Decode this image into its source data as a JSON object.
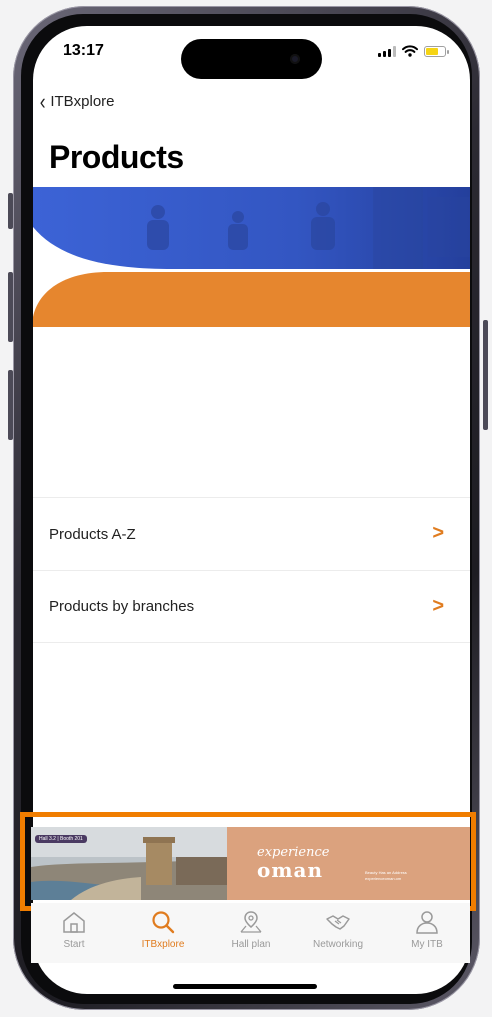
{
  "status_bar": {
    "time": "13:17"
  },
  "nav": {
    "back_label": "ITBxplore"
  },
  "page": {
    "title": "Products"
  },
  "list": {
    "items": [
      {
        "label": "Products A-Z",
        "arrow": ">"
      },
      {
        "label": "Products by branches",
        "arrow": ">"
      }
    ]
  },
  "ad": {
    "tag": "Hall 3.2 | Booth 201",
    "headline_small": "experience",
    "headline_big": "oman",
    "fine_print_1": "Beauty Has an Address",
    "fine_print_2": "experienceoman.om"
  },
  "tab_bar": {
    "items": [
      {
        "label": "Start",
        "icon": "home-icon",
        "active": false
      },
      {
        "label": "ITBxplore",
        "icon": "search-icon",
        "active": true
      },
      {
        "label": "Hall plan",
        "icon": "map-icon",
        "active": false
      },
      {
        "label": "Networking",
        "icon": "handshake-icon",
        "active": false
      },
      {
        "label": "My ITB",
        "icon": "user-icon",
        "active": false
      }
    ]
  },
  "colors": {
    "accent": "#e07c1f",
    "banner_blue": "#3b5fd0",
    "banner_orange": "#e6862e",
    "highlight": "#f07d00"
  }
}
